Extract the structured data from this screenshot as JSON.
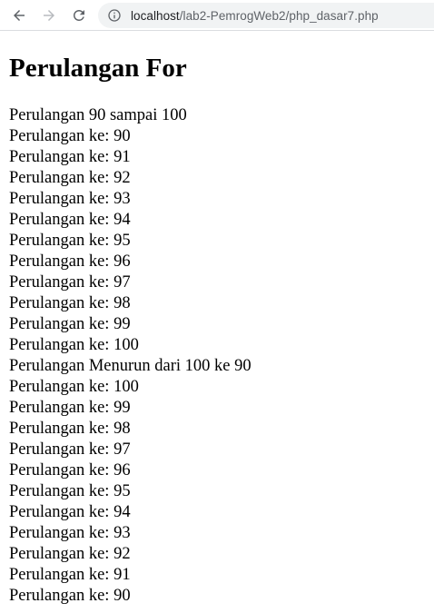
{
  "browser": {
    "url_host": "localhost",
    "url_path": "/lab2-PemrogWeb2/php_dasar7.php"
  },
  "page": {
    "title": "Perulangan For",
    "lines": [
      "Perulangan 90 sampai 100",
      "Perulangan ke: 90",
      "Perulangan ke: 91",
      "Perulangan ke: 92",
      "Perulangan ke: 93",
      "Perulangan ke: 94",
      "Perulangan ke: 95",
      "Perulangan ke: 96",
      "Perulangan ke: 97",
      "Perulangan ke: 98",
      "Perulangan ke: 99",
      "Perulangan ke: 100",
      "Perulangan Menurun dari 100 ke 90",
      "Perulangan ke: 100",
      "Perulangan ke: 99",
      "Perulangan ke: 98",
      "Perulangan ke: 97",
      "Perulangan ke: 96",
      "Perulangan ke: 95",
      "Perulangan ke: 94",
      "Perulangan ke: 93",
      "Perulangan ke: 92",
      "Perulangan ke: 91",
      "Perulangan ke: 90"
    ]
  }
}
